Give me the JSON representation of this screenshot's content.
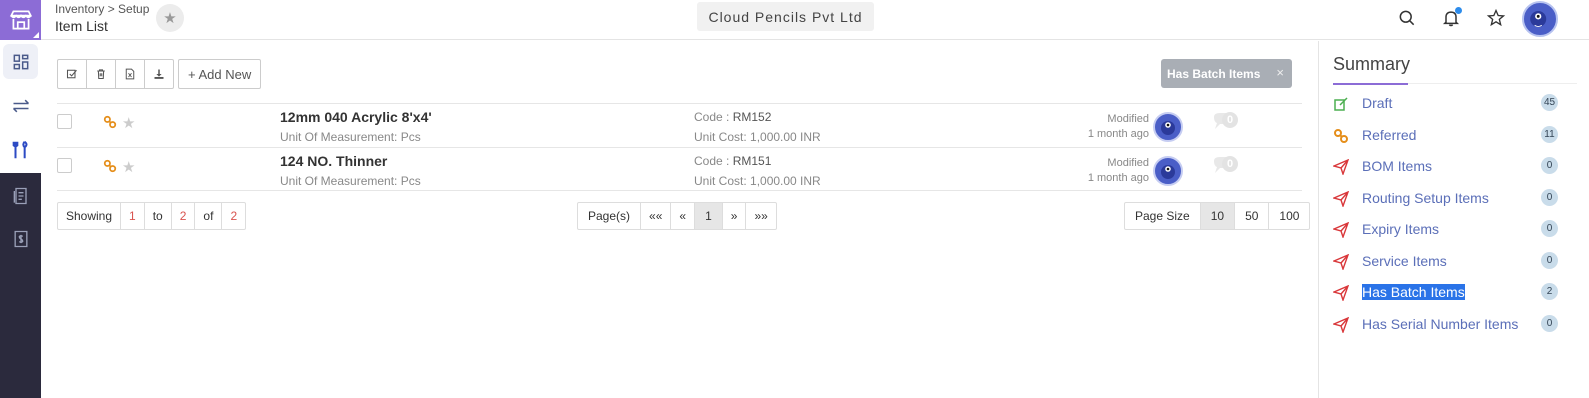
{
  "header": {
    "breadcrumb": "Inventory > Setup",
    "title": "Item List",
    "company": "Cloud Pencils Pvt Ltd"
  },
  "rail": {
    "icons": [
      "store-icon",
      "dashboard-icon",
      "transfer-icon",
      "tools-icon",
      "document-icon",
      "invoice-icon"
    ]
  },
  "toolbar": {
    "add_new": "+ Add New"
  },
  "filter": {
    "label": "Has Batch Items",
    "close": "×"
  },
  "items": [
    {
      "name": "12mm 040 Acrylic 8'x4'",
      "uom": "Unit Of Measurement: Pcs",
      "code_label": "Code : ",
      "code": "RM152",
      "cost": "Unit Cost: 1,000.00 INR",
      "modified": "Modified",
      "ago": "1 month ago",
      "comments": "0"
    },
    {
      "name": "124 NO. Thinner",
      "uom": "Unit Of Measurement: Pcs",
      "code_label": "Code : ",
      "code": "RM151",
      "cost": "Unit Cost: 1,000.00 INR",
      "modified": "Modified",
      "ago": "1 month ago",
      "comments": "0"
    }
  ],
  "showing": {
    "label": "Showing",
    "from": "1",
    "to_label": "to",
    "to": "2",
    "of_label": "of",
    "total": "2"
  },
  "pages": {
    "label": "Page(s)",
    "first": "««",
    "prev": "«",
    "current": "1",
    "next": "»",
    "last": "»»"
  },
  "page_size": {
    "label": "Page Size",
    "options": [
      "10",
      "50",
      "100"
    ],
    "selected": "10"
  },
  "summary": {
    "title": "Summary",
    "items": [
      {
        "label": "Draft",
        "count": "45",
        "icon": "edit-icon"
      },
      {
        "label": "Referred",
        "count": "11",
        "icon": "link-icon"
      },
      {
        "label": "BOM Items",
        "count": "0",
        "icon": "send-icon"
      },
      {
        "label": "Routing Setup Items",
        "count": "0",
        "icon": "send-icon"
      },
      {
        "label": "Expiry Items",
        "count": "0",
        "icon": "send-icon"
      },
      {
        "label": "Service Items",
        "count": "0",
        "icon": "send-icon"
      },
      {
        "label": "Has Batch Items",
        "count": "2",
        "icon": "send-icon"
      },
      {
        "label": "Has Serial Number Items",
        "count": "0",
        "icon": "send-icon"
      }
    ]
  },
  "colors": {
    "brand": "#8c6cd6",
    "rail": "#2b2a3d",
    "link": "#5b6fb8",
    "selection": "#2a73e8"
  }
}
